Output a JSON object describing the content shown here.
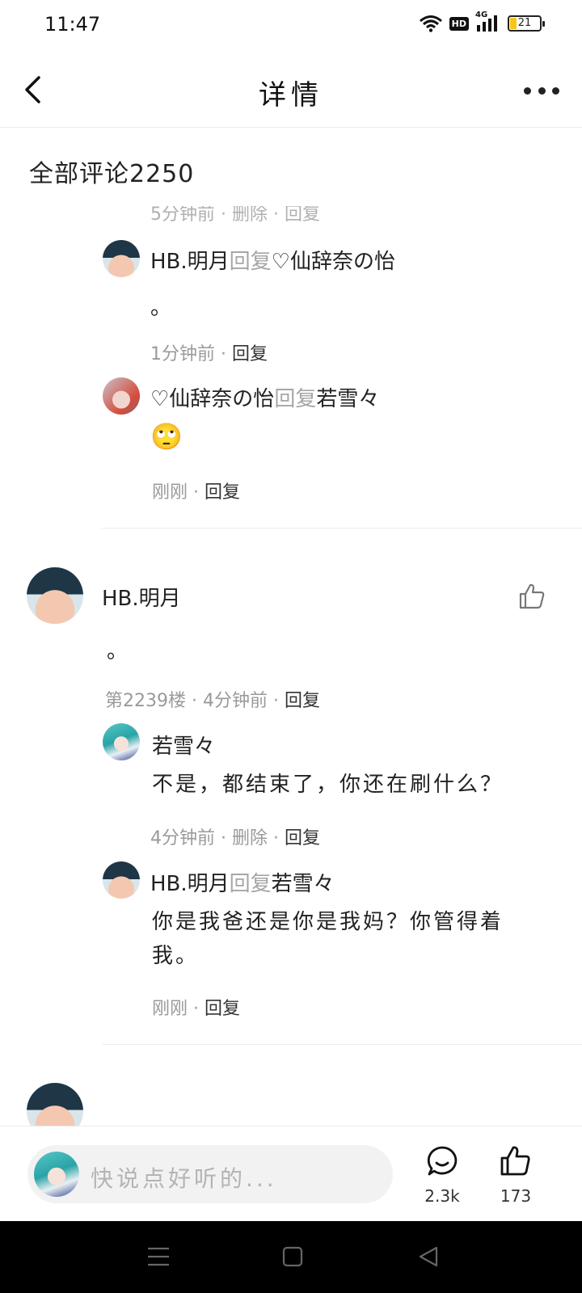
{
  "status": {
    "time": "11:47",
    "hd": "HD",
    "network": "4G",
    "battery": "21"
  },
  "nav": {
    "title": "详情"
  },
  "comments_header": "全部评论2250",
  "reply_thread_top": {
    "cut_meta": "5分钟前 · 删除 · 回复",
    "replies": [
      {
        "user": "HB.明月",
        "reply_word": "回复",
        "target": "♡仙辞奈の怡",
        "text": "。",
        "time": "1分钟前",
        "reply_label": "回复"
      },
      {
        "user": "♡仙辞奈の怡",
        "reply_word": "回复",
        "target": "若雪々",
        "emoji": "🙄",
        "time": "刚刚",
        "reply_label": "回复"
      }
    ]
  },
  "comment": {
    "user": "HB.明月",
    "text": "。",
    "floor": "第2239楼",
    "time": "4分钟前",
    "reply_label": "回复",
    "replies": [
      {
        "user": "若雪々",
        "text": "不是，都结束了，你还在刷什么？",
        "time": "4分钟前",
        "delete_label": "删除",
        "reply_label": "回复"
      },
      {
        "user": "HB.明月",
        "reply_word": "回复",
        "target": "若雪々",
        "text": "你是我爸还是你是我妈？你管得着我。",
        "time": "刚刚",
        "reply_label": "回复"
      }
    ]
  },
  "bottom": {
    "input_placeholder": "快说点好听的...",
    "comment_count": "2.3k",
    "like_count": "173"
  },
  "icons": {
    "back": "chevron-left-icon",
    "more": "more-dots-icon",
    "like": "thumbs-up-icon",
    "comment": "comment-bubble-icon",
    "wifi": "wifi-icon",
    "signal": "signal-icon",
    "battery": "battery-icon"
  }
}
